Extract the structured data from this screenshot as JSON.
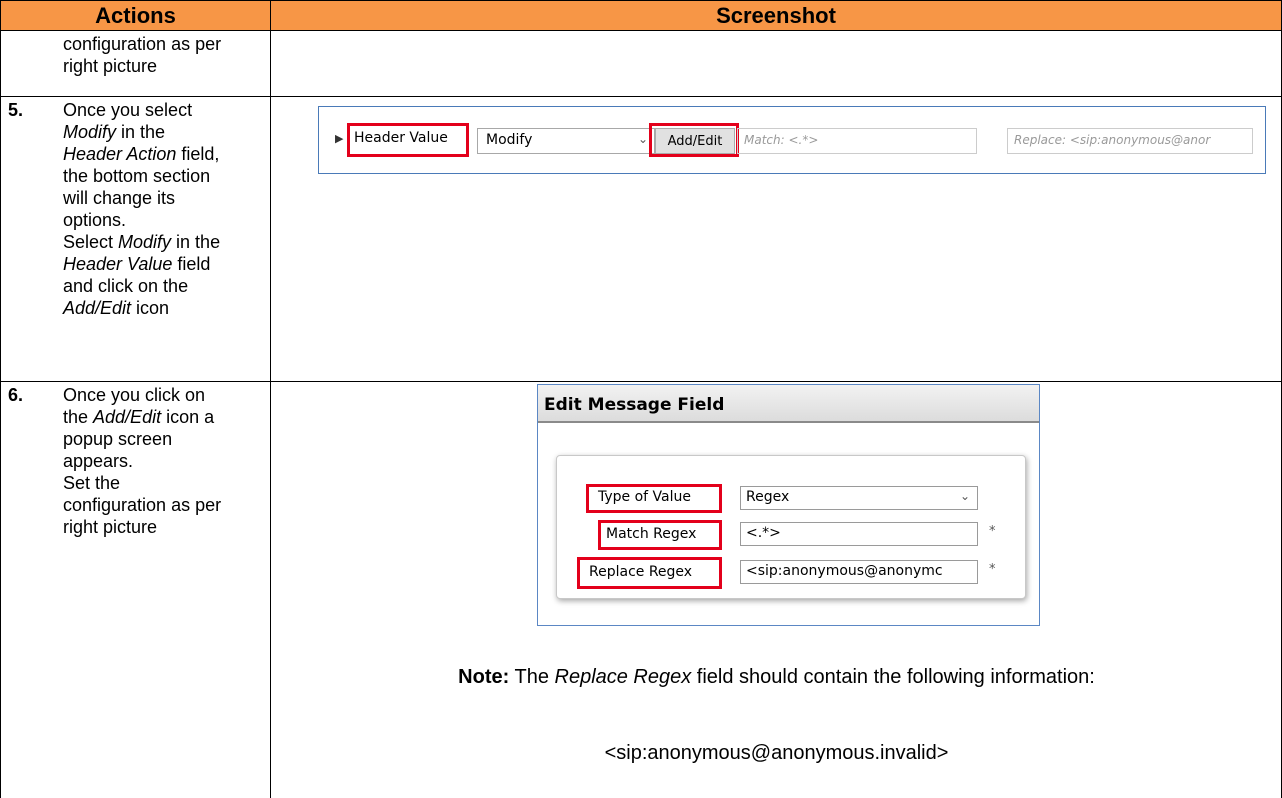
{
  "table": {
    "headers": {
      "actions": "Actions",
      "screenshot": "Screenshot"
    },
    "rows": [
      {
        "lines": [
          "configuration as per",
          "right picture"
        ]
      },
      {
        "number": "5.",
        "lines": [
          [
            "Once you select",
            ""
          ],
          [
            "",
            "Modify",
            " in the"
          ],
          [
            "",
            "Header Action",
            " field,"
          ],
          [
            "the bottom section"
          ],
          [
            "will change its"
          ],
          [
            "options."
          ],
          [
            "Select ",
            "Modify",
            " in the"
          ],
          [
            "",
            "Header Value",
            " field"
          ],
          [
            "and click on the"
          ],
          [
            "",
            "Add/Edit",
            " icon"
          ]
        ]
      },
      {
        "number": "6.",
        "lines": [
          [
            "Once you click on"
          ],
          [
            "the ",
            "Add/Edit",
            " icon a"
          ],
          [
            "popup screen"
          ],
          [
            "appears."
          ],
          [
            "Set the"
          ],
          [
            "configuration as per"
          ],
          [
            "right picture"
          ]
        ]
      }
    ]
  },
  "header_value_row": {
    "label": "Header Value",
    "select_value": "Modify",
    "button_label": "Add/Edit",
    "match_placeholder": "Match: <.*>",
    "replace_placeholder": "Replace: <sip:anonymous@anor"
  },
  "popup": {
    "title": "Edit Message Field",
    "type_label": "Type of Value",
    "type_value": "Regex",
    "match_label": "Match Regex",
    "match_value": "<.*>",
    "replace_label": "Replace Regex",
    "replace_value": "<sip:anonymous@anonymc",
    "required_mark": "*"
  },
  "note": {
    "prefix": "Note:",
    "text_before": " The ",
    "field_name": "Replace Regex",
    "text_after": " field should contain the following information:",
    "value": "<sip:anonymous@anonymous.invalid>"
  },
  "colors": {
    "header_bg": "#F79646",
    "highlight": "#e3001b"
  }
}
